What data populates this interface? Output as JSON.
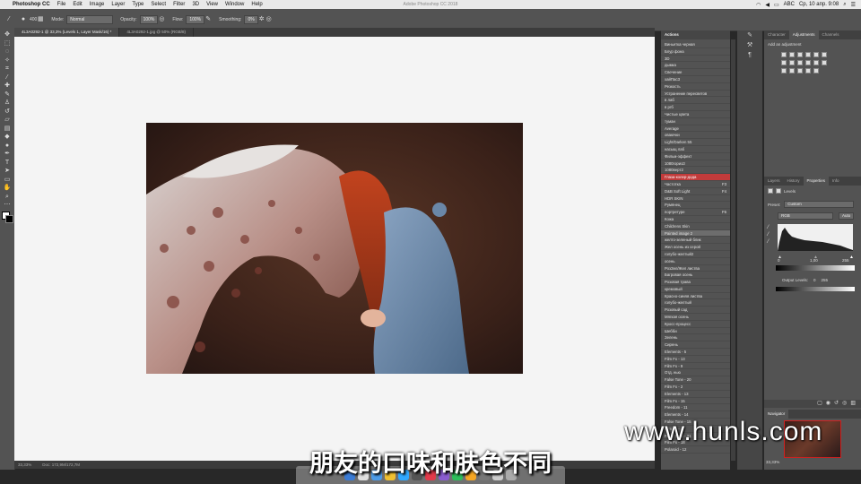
{
  "menubar": {
    "app_name": "Photoshop CC",
    "items": [
      "File",
      "Edit",
      "Image",
      "Layer",
      "Type",
      "Select",
      "Filter",
      "3D",
      "View",
      "Window",
      "Help"
    ],
    "window_title": "Adobe Photoshop CC 2018",
    "lang": "ABC",
    "clock": "Ср, 10 апр. 9:08"
  },
  "options": {
    "brush_size": "400",
    "mode_label": "Mode:",
    "mode_value": "Normal",
    "opacity_label": "Opacity:",
    "opacity_value": "100%",
    "flow_label": "Flow:",
    "flow_value": "100%",
    "smoothing_label": "Smoothing:",
    "smoothing_value": "0%"
  },
  "tabs": [
    {
      "label": "4L3A0292-1 @ 33,3% (Levels 1, Layer Mask/16) *"
    },
    {
      "label": "4L3A0292-1.jpg @ 50% (RGB/8)"
    }
  ],
  "status": {
    "zoom": "33,33%",
    "doc": "Doc: 172,9M/172,7M"
  },
  "actions": {
    "title": "Actions",
    "rows": [
      {
        "label": "Виньетка черная",
        "key": "",
        "style": ""
      },
      {
        "label": "Блур фона",
        "key": "",
        "style": ""
      },
      {
        "label": "3D",
        "key": "",
        "style": ""
      },
      {
        "label": "дымка",
        "key": "",
        "style": ""
      },
      {
        "label": "Свечение",
        "key": "",
        "style": ""
      },
      {
        "label": "хайПасЗ",
        "key": "",
        "style": ""
      },
      {
        "label": "Резкость",
        "key": "",
        "style": ""
      },
      {
        "label": "Устранение пересветов",
        "key": "",
        "style": ""
      },
      {
        "label": "в лаб",
        "key": "",
        "style": ""
      },
      {
        "label": "в ргб",
        "key": "",
        "style": ""
      },
      {
        "label": "Чистые цвета",
        "key": "",
        "style": ""
      },
      {
        "label": "туман",
        "key": "",
        "style": ""
      },
      {
        "label": "Average",
        "key": "",
        "style": ""
      },
      {
        "label": "оваючки",
        "key": "",
        "style": ""
      },
      {
        "label": "Light/Darken 55",
        "key": "",
        "style": ""
      },
      {
        "label": "насыщ лаб",
        "key": "",
        "style": ""
      },
      {
        "label": "Фильм-эффект",
        "key": "",
        "style": ""
      },
      {
        "label": "1080горизЗ",
        "key": "",
        "style": ""
      },
      {
        "label": "1080верт2",
        "key": "",
        "style": ""
      },
      {
        "label": "Глаза-колер-дода",
        "key": "",
        "style": "red"
      },
      {
        "label": "Частотка",
        "key": "F3",
        "style": ""
      },
      {
        "label": "D&B Soft Light",
        "key": "F4",
        "style": ""
      },
      {
        "label": "HDR SKIN",
        "key": "",
        "style": ""
      },
      {
        "label": "Румянец",
        "key": "",
        "style": ""
      },
      {
        "label": "портретуре",
        "key": "F6",
        "style": ""
      },
      {
        "label": "Кожа",
        "key": "",
        "style": ""
      },
      {
        "label": "Childrens Skin",
        "key": "",
        "style": ""
      },
      {
        "label": "Painted image 2",
        "key": "",
        "style": "sel"
      },
      {
        "label": "желто-зеленый блик",
        "key": "",
        "style": ""
      },
      {
        "label": "Жел осень из серой",
        "key": "",
        "style": ""
      },
      {
        "label": "голубо-желтый2",
        "key": "",
        "style": ""
      },
      {
        "label": "осень",
        "key": "",
        "style": ""
      },
      {
        "label": "РозЗел/Жел листва",
        "key": "",
        "style": ""
      },
      {
        "label": "Багровая осень",
        "key": "",
        "style": ""
      },
      {
        "label": "Розовая трава",
        "key": "",
        "style": ""
      },
      {
        "label": "кремовый",
        "key": "",
        "style": ""
      },
      {
        "label": "Красно-синяя листва",
        "key": "",
        "style": ""
      },
      {
        "label": "голубо-желтый",
        "key": "",
        "style": ""
      },
      {
        "label": "Розовый сад",
        "key": "",
        "style": ""
      },
      {
        "label": "Мягкая осень",
        "key": "",
        "style": ""
      },
      {
        "label": "Кросс-процесс",
        "key": "",
        "style": ""
      },
      {
        "label": "Шебби",
        "key": "",
        "style": ""
      },
      {
        "label": "Зелень",
        "key": "",
        "style": ""
      },
      {
        "label": "Сирень",
        "key": "",
        "style": ""
      },
      {
        "label": "Elements - 5",
        "key": "",
        "style": ""
      },
      {
        "label": "Film Fx - 13",
        "key": "",
        "style": ""
      },
      {
        "label": "Film Fx - 9",
        "key": "",
        "style": ""
      },
      {
        "label": "Отд. нью",
        "key": "",
        "style": ""
      },
      {
        "label": "False Tone - 20",
        "key": "",
        "style": ""
      },
      {
        "label": "Film Fx - 2",
        "key": "",
        "style": ""
      },
      {
        "label": "Elements - 13",
        "key": "",
        "style": ""
      },
      {
        "label": "Film Fx - 15",
        "key": "",
        "style": ""
      },
      {
        "label": "Freedom - 11",
        "key": "",
        "style": ""
      },
      {
        "label": "Elements - 14",
        "key": "",
        "style": ""
      },
      {
        "label": "False Tone - 15",
        "key": "",
        "style": ""
      },
      {
        "label": "Film Fx - 4",
        "key": "",
        "style": ""
      },
      {
        "label": "False Tone - 21",
        "key": "",
        "style": ""
      },
      {
        "label": "Film Fx - 18",
        "key": "",
        "style": ""
      },
      {
        "label": "Polaroid - 12",
        "key": "",
        "style": ""
      }
    ]
  },
  "adjustments": {
    "tabs": [
      "Character",
      "Adjustments",
      "Channels"
    ],
    "active_tab": "Adjustments",
    "heading": "Add an adjustment"
  },
  "properties": {
    "tabs": [
      "Layers",
      "History",
      "Properties",
      "Info"
    ],
    "active_tab": "Properties",
    "panel_title": "Levels",
    "preset_label": "Preset:",
    "preset_value": "Custom",
    "channel_value": "RGB",
    "auto_label": "Auto",
    "input_black": "0",
    "input_gamma": "1,00",
    "input_white": "255",
    "output_label": "Output Levels:",
    "output_black": "0",
    "output_white": "255"
  },
  "navigator": {
    "title": "Navigator",
    "zoom": "33,33%"
  },
  "overlay": {
    "watermark": "www.hunls.com",
    "subtitle": "朋友的口味和肤色不同"
  },
  "colors": {
    "panel_bg": "#535353",
    "highlight_red": "#c23b3b",
    "canvas_bg": "#f4f4f4"
  }
}
